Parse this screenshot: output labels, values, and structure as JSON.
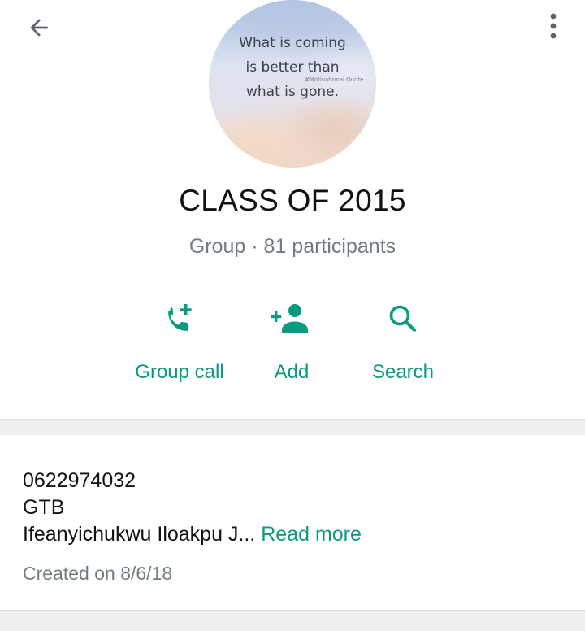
{
  "nav": {
    "back_icon": "arrow-left-icon",
    "menu_icon": "more-vertical-icon"
  },
  "group": {
    "avatar_text": "What is coming\nis better than\nwhat is gone.",
    "avatar_small_text": "#Motivational Quote",
    "name": "CLASS OF 2015",
    "meta": "Group · 81 participants"
  },
  "actions": [
    {
      "label": "Group call",
      "icon": "add-call-icon"
    },
    {
      "label": "Add",
      "icon": "add-person-icon"
    },
    {
      "label": "Search",
      "icon": "search-icon"
    }
  ],
  "description": {
    "lines": [
      "0622974032",
      "GTB",
      "Ifeanyichukwu Iloakpu J..."
    ],
    "read_more": "Read more",
    "created": "Created on 8/6/18"
  },
  "colors": {
    "accent": "#0a9a7f",
    "secondary_text": "#707b82",
    "divider": "#eef0ef"
  }
}
